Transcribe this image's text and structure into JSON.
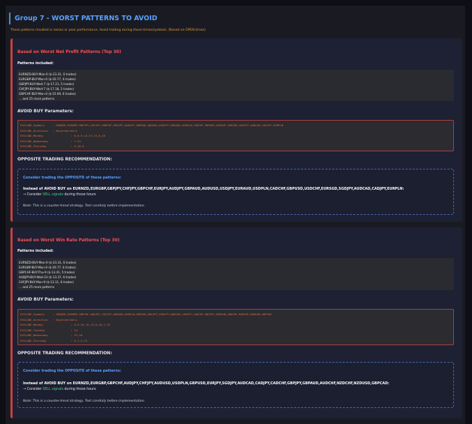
{
  "group": {
    "title": "Group 7 - WORST PATTERNS TO AVOID",
    "description": "These patterns resulted in losses or poor performance. Avoid trading during these times/symbols. (Based on OPEN times)"
  },
  "cards": [
    {
      "title": "Based on Worst Net Profit Patterns (Top 30)",
      "patterns_label": "Patterns included:",
      "patterns": [
        "EURNZD-BUY-Mon-0 ($-23.31, 6 trades)",
        "EURGBP-BUY-Mon-0 ($-20.77, 6 trades)",
        "GBPJPY-BUY-Wed-7 ($-17.21, 5 trades)",
        "CHFJPY-BUY-Wed-7 ($-17.18, 5 trades)",
        "GBPCHF-BUY-Mon-0 ($-15.69, 6 trades)"
      ],
      "more": "... and 25 more patterns",
      "params_label": "AVOID BUY Parameters:",
      "code_lines": [
        "EXCLUDE_Symbols     : EURNZD,EURGBP,GBPJPY,CHFJPY,GBPCHF,EURJPY,AUDJPY,GBPAUD,AUDUSD,USDJPY,EURAUD,USDPLN,CADCHF,GBPUSD,USDCHF,EURSGD,SGDJPY,AUDCAD,CADJPY,EURPLN",
        "EXCLUDE_Direction   : BuyOrdersOnly",
        "EXCLUDE_Monday                 : 0,6,9,14,15,13,8,18",
        "EXCLUDE_Wednesday              : 7,23",
        "EXCLUDE_Thursday               : 4,16,9"
      ],
      "opposite_label": "OPPOSITE TRADING RECOMMENDATION:",
      "opp_title": "Consider trading the OPPOSITE of these patterns:",
      "opp_instead": "Instead of AVOID BUY on EURNZD,EURGBP,GBPJPY,CHFJPY,GBPCHF,EURJPY,AUDJPY,GBPAUD,AUDUSD,USDJPY,EURAUD,USDPLN,CADCHF,GBPUSD,USDCHF,EURSGD,SGDJPY,AUDCAD,CADJPY,EURPLN:",
      "opp_consider_prefix": "→ Consider ",
      "opp_sell": "SELL signals",
      "opp_consider_suffix": " during those hours",
      "opp_note": "Note: This is a counter-trend strategy. Test carefully before implementation."
    },
    {
      "title": "Based on Worst Win Rate Patterns (Top 30)",
      "patterns_label": "Patterns included:",
      "patterns": [
        "EURNZD-BUY-Mon-0 ($-23.31, 6 trades)",
        "EURGBP-BUY-Mon-0 ($-20.77, 6 trades)",
        "GBPCHF-BUY-Thu-9 ($-13.41, 5 trades)",
        "AUDJPY-BUY-Wed-23 ($-13.37, 6 trades)",
        "CHFJPY-BUY-Mon-9 ($-13.11, 6 trades)"
      ],
      "more": "... and 25 more patterns",
      "params_label": "AVOID BUY Parameters:",
      "code_lines": [
        "EXCLUDE_Symbols     : EURNZD,EURGBP,GBPCHF,AUDJPY,CHFJPY,AUDUSD,USDPLN,GBPUSD,EURJPY,SGDJPY,AUDCAD,CADJPY,CADCHF,GBPJPY,GBPAUD,AUDCHF,NZDCHF,NZDUSD,GBPCAD",
        "EXCLUDE_Direction   : BuyOrdersOnly",
        "EXCLUDE_Monday                 : 0,9,16,15,13,8,18,1,23",
        "EXCLUDE_Tuesday                : 14",
        "EXCLUDE_Wednesday              : 23,16",
        "EXCLUDE_Thursday               : 9,1,3,23"
      ],
      "opposite_label": "OPPOSITE TRADING RECOMMENDATION:",
      "opp_title": "Consider trading the OPPOSITE of these patterns:",
      "opp_instead": "Instead of AVOID BUY on EURNZD,EURGBP,GBPCHF,AUDJPY,CHFJPY,AUDUSD,USDPLN,GBPUSD,EURJPY,SGDJPY,AUDCAD,CADJPY,CADCHF,GBPJPY,GBPAUD,AUDCHF,NZDCHF,NZDUSD,GBPCAD:",
      "opp_consider_prefix": "→ Consider ",
      "opp_sell": "SELL signals",
      "opp_consider_suffix": " during those hours",
      "opp_note": "Note: This is a counter-trend strategy. Test carefully before implementation."
    }
  ],
  "colors": {
    "accent_blue": "#5aa0ff",
    "danger_red": "#ff5050",
    "warning_orange": "#e0a040",
    "sell_green": "#4ad080"
  }
}
